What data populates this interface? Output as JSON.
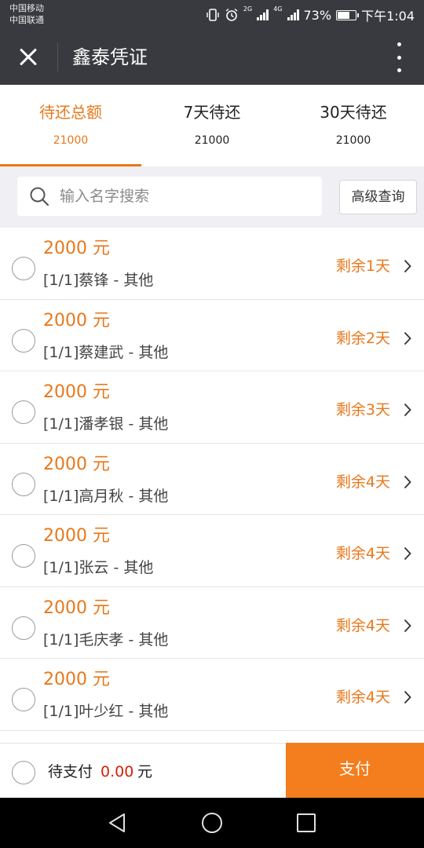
{
  "status_bar": {
    "carrier_1": "中国移动",
    "carrier_2": "中国联通",
    "net_1": "2G",
    "net_2": "4G",
    "battery": "73%",
    "battery_level": 0.73,
    "time": "下午1:04"
  },
  "header": {
    "title": "鑫泰凭证"
  },
  "tabs": [
    {
      "label": "待还总额",
      "count": "21000",
      "active": true
    },
    {
      "label": "7天待还",
      "count": "21000",
      "active": false
    },
    {
      "label": "30天待还",
      "count": "21000",
      "active": false
    }
  ],
  "search": {
    "placeholder": "输入名字搜索",
    "advanced_label": "高级查询"
  },
  "list": {
    "items": [
      {
        "amount": "2000 元",
        "desc": "[1/1]蔡锋 - 其他",
        "remain": "剩余1天"
      },
      {
        "amount": "2000 元",
        "desc": "[1/1]蔡建武 - 其他",
        "remain": "剩余2天"
      },
      {
        "amount": "2000 元",
        "desc": "[1/1]潘孝银 - 其他",
        "remain": "剩余3天"
      },
      {
        "amount": "2000 元",
        "desc": "[1/1]高月秋 - 其他",
        "remain": "剩余4天"
      },
      {
        "amount": "2000 元",
        "desc": "[1/1]张云 - 其他",
        "remain": "剩余4天"
      },
      {
        "amount": "2000 元",
        "desc": "[1/1]毛庆孝 - 其他",
        "remain": "剩余4天"
      },
      {
        "amount": "2000 元",
        "desc": "[1/1]叶少红 - 其他",
        "remain": "剩余4天"
      }
    ]
  },
  "bottom": {
    "pending_label": "待支付",
    "pending_amount": "0.00",
    "unit": "元",
    "pay_label": "支付"
  },
  "colors": {
    "accent": "#e8781b",
    "pay_button": "#f47d1d",
    "amount_red": "#d81e06",
    "header_bg": "#393a3f"
  }
}
